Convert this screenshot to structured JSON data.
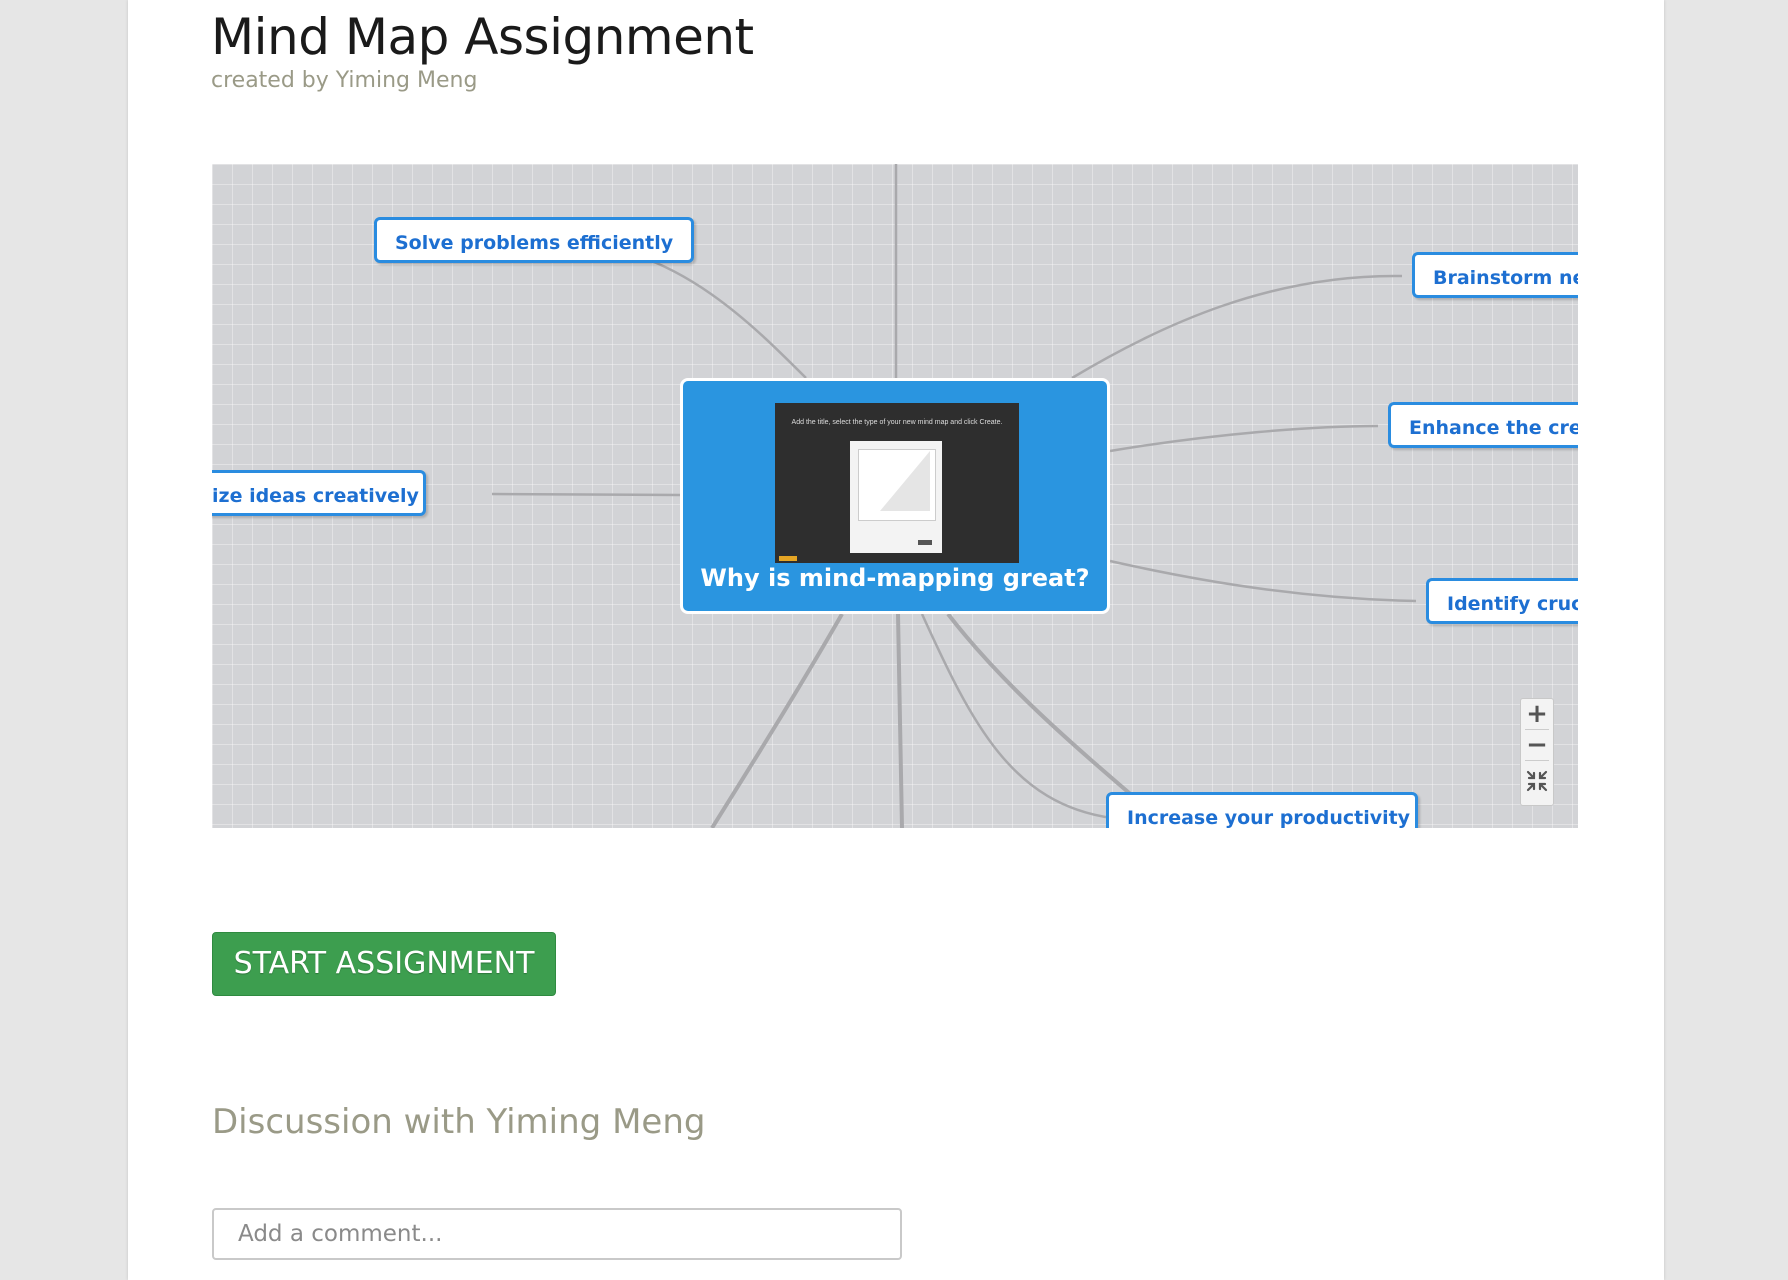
{
  "header": {
    "title": "Mind Map Assignment",
    "subtitle": "created by Yiming Meng"
  },
  "mindmap": {
    "central_topic": "Why is mind-mapping great?",
    "thumbnail_text": "Add the title, select the type of your new mind map and click Create.",
    "nodes": [
      "Solve problems efficiently",
      "Brainstorm ne",
      "Enhance the crea",
      "ize ideas creatively",
      "Identify cruc",
      "Increase your productivity"
    ],
    "zoom_in_label": "+",
    "zoom_out_label": "−",
    "colors": {
      "node_border": "#2a8ce0",
      "node_text": "#1d6fd1",
      "central_bg": "#2a95e0",
      "canvas_bg": "#d2d3d6"
    }
  },
  "actions": {
    "start_label": "START ASSIGNMENT",
    "start_color": "#3d9e4f"
  },
  "discussion": {
    "heading": "Discussion with Yiming Meng",
    "comment_placeholder": "Add a comment..."
  }
}
